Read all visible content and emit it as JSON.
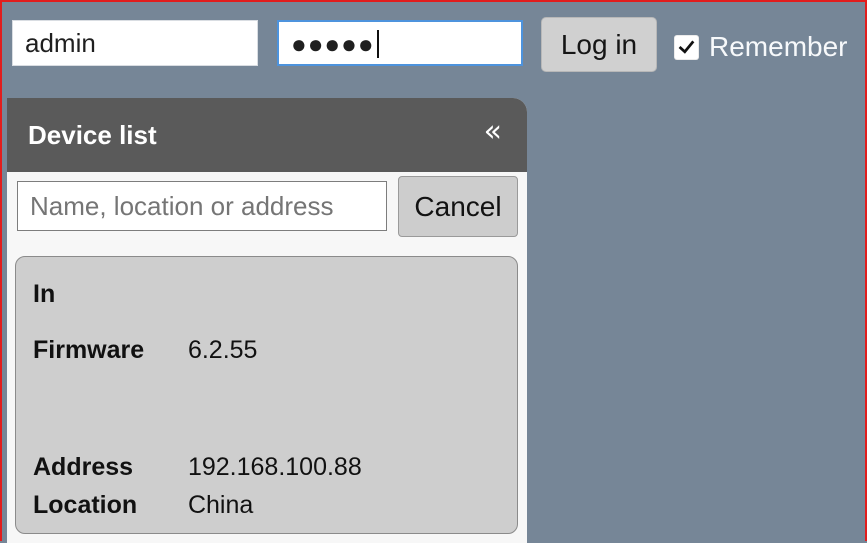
{
  "login": {
    "username": "admin",
    "password_mask": "●●●●●",
    "button_label": "Log in",
    "remember_label": "Remember"
  },
  "device_panel": {
    "title": "Device list",
    "collapse_icon": "«",
    "search_placeholder": "Name, location or address",
    "cancel_label": "Cancel",
    "device": {
      "name": "In",
      "firmware_label": "Firmware",
      "firmware_value": "6.2.55",
      "address_label": "Address",
      "address_value": "192.168.100.88",
      "location_label": "Location",
      "location_value": "China"
    }
  },
  "colors": {
    "background": "#768697",
    "panel_header": "#5a5a5a",
    "focus_border": "#4d93dd",
    "window_border": "#e21d1d"
  },
  "icons": {
    "collapse": "double-chevron-left-icon",
    "checkbox": "checkmark-icon"
  }
}
